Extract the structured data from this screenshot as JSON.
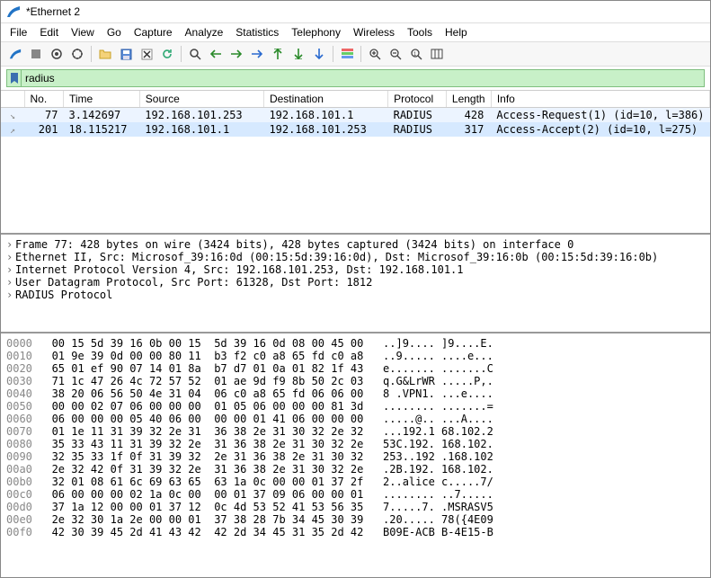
{
  "window": {
    "title": "*Ethernet 2"
  },
  "menu": [
    "File",
    "Edit",
    "View",
    "Go",
    "Capture",
    "Analyze",
    "Statistics",
    "Telephony",
    "Wireless",
    "Tools",
    "Help"
  ],
  "filter": {
    "value": "radius"
  },
  "packet_columns": [
    "No.",
    "Time",
    "Source",
    "Destination",
    "Protocol",
    "Length",
    "Info"
  ],
  "packets": [
    {
      "no": "77",
      "time": "3.142697",
      "src": "192.168.101.253",
      "dst": "192.168.101.1",
      "proto": "RADIUS",
      "len": "428",
      "info": "Access-Request(1) (id=10, l=386)",
      "mark": "↘"
    },
    {
      "no": "201",
      "time": "18.115217",
      "src": "192.168.101.1",
      "dst": "192.168.101.253",
      "proto": "RADIUS",
      "len": "317",
      "info": "Access-Accept(2) (id=10, l=275)",
      "mark": "↗"
    }
  ],
  "details": [
    "Frame 77: 428 bytes on wire (3424 bits), 428 bytes captured (3424 bits) on interface 0",
    "Ethernet II, Src: Microsof_39:16:0d (00:15:5d:39:16:0d), Dst: Microsof_39:16:0b (00:15:5d:39:16:0b)",
    "Internet Protocol Version 4, Src: 192.168.101.253, Dst: 192.168.101.1",
    "User Datagram Protocol, Src Port: 61328, Dst Port: 1812",
    "RADIUS Protocol"
  ],
  "hex": [
    {
      "o": "0000",
      "b": "00 15 5d 39 16 0b 00 15  5d 39 16 0d 08 00 45 00",
      "a": "..]9.... ]9....E."
    },
    {
      "o": "0010",
      "b": "01 9e 39 0d 00 00 80 11  b3 f2 c0 a8 65 fd c0 a8",
      "a": "..9..... ....e..."
    },
    {
      "o": "0020",
      "b": "65 01 ef 90 07 14 01 8a  b7 d7 01 0a 01 82 1f 43",
      "a": "e....... .......C"
    },
    {
      "o": "0030",
      "b": "71 1c 47 26 4c 72 57 52  01 ae 9d f9 8b 50 2c 03",
      "a": "q.G&LrWR .....P,."
    },
    {
      "o": "0040",
      "b": "38 20 06 56 50 4e 31 04  06 c0 a8 65 fd 06 06 00",
      "a": "8 .VPN1. ...e...."
    },
    {
      "o": "0050",
      "b": "00 00 02 07 06 00 00 00  01 05 06 00 00 00 81 3d",
      "a": "........ .......="
    },
    {
      "o": "0060",
      "b": "06 00 00 00 05 40 06 00  00 00 01 41 06 00 00 00",
      "a": ".....@.. ...A...."
    },
    {
      "o": "0070",
      "b": "01 1e 11 31 39 32 2e 31  36 38 2e 31 30 32 2e 32",
      "a": "...192.1 68.102.2"
    },
    {
      "o": "0080",
      "b": "35 33 43 11 31 39 32 2e  31 36 38 2e 31 30 32 2e",
      "a": "53C.192. 168.102."
    },
    {
      "o": "0090",
      "b": "32 35 33 1f 0f 31 39 32  2e 31 36 38 2e 31 30 32",
      "a": "253..192 .168.102"
    },
    {
      "o": "00a0",
      "b": "2e 32 42 0f 31 39 32 2e  31 36 38 2e 31 30 32 2e",
      "a": ".2B.192. 168.102."
    },
    {
      "o": "00b0",
      "b": "32 01 08 61 6c 69 63 65  63 1a 0c 00 00 01 37 2f",
      "a": "2..alice c.....7/"
    },
    {
      "o": "00c0",
      "b": "06 00 00 00 02 1a 0c 00  00 01 37 09 06 00 00 01",
      "a": "........ ..7....."
    },
    {
      "o": "00d0",
      "b": "37 1a 12 00 00 01 37 12  0c 4d 53 52 41 53 56 35",
      "a": "7.....7. .MSRASV5"
    },
    {
      "o": "00e0",
      "b": "2e 32 30 1a 2e 00 00 01  37 38 28 7b 34 45 30 39",
      "a": ".20..... 78({4E09"
    },
    {
      "o": "00f0",
      "b": "42 30 39 45 2d 41 43 42  42 2d 34 45 31 35 2d 42",
      "a": "B09E-ACB B-4E15-B"
    }
  ]
}
